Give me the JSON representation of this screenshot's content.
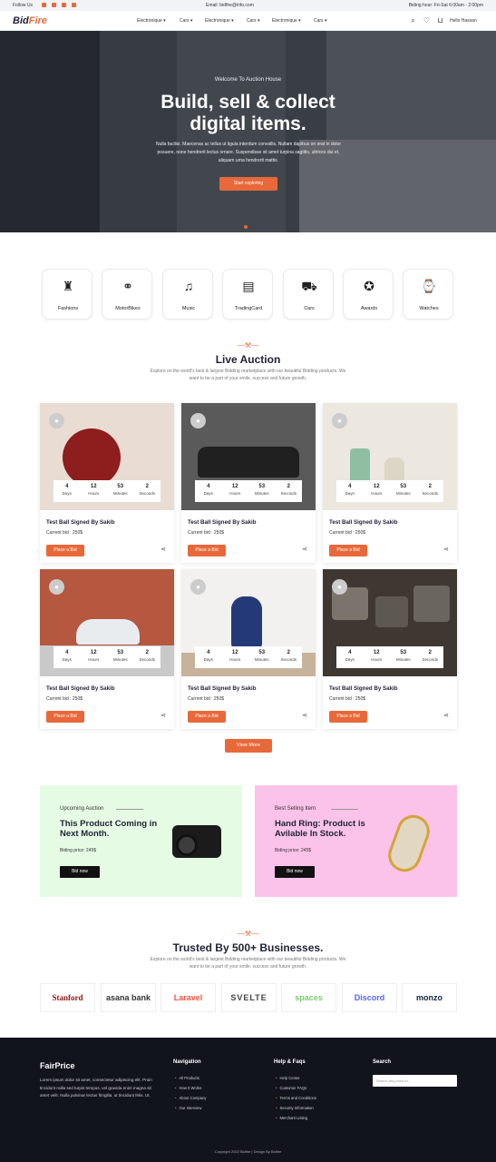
{
  "topbar": {
    "follow": "Follow Us",
    "email": "Email: bidfire@info.com",
    "hours": "Biding hour: Fri-Sat 6:00am - 2:00pm"
  },
  "nav": {
    "logo_a": "Bid",
    "logo_b": "Fire",
    "items": [
      "Electronique",
      "Cars",
      "Electronique",
      "Cars",
      "Electronique",
      "Cars"
    ],
    "user": "Hello Hassan"
  },
  "hero": {
    "kicker": "Welcome To Auction House",
    "title_line1": "Build, sell & collect",
    "title_line2": "digital items.",
    "subtitle": "Nulla facilisi. Maecenas ac tellus ut ligula interdum convallis. Nullam dapibus on erat in dolor posuere, none hendrerit lectus ornare. Suspendisse sit amet turpina sagittis, ultrices dui et, aliquam urna hendrerit mattis.",
    "cta": "Start exploring"
  },
  "categories": [
    {
      "label": "Fashions",
      "icon": "fashion-icon"
    },
    {
      "label": "MotorBikes",
      "icon": "motorbike-icon"
    },
    {
      "label": "Music",
      "icon": "music-icon"
    },
    {
      "label": "TradingCard",
      "icon": "trading-card-icon"
    },
    {
      "label": "Cars",
      "icon": "car-icon"
    },
    {
      "label": "Awards",
      "icon": "award-icon"
    },
    {
      "label": "Watches",
      "icon": "watch-icon"
    }
  ],
  "live": {
    "title": "Live Auction",
    "subtitle": "Explore on the world's best & largest Bidding marketplace with our beautiful Bidding products. We want to be a part of your smile, success and future growth.",
    "units": [
      "Days",
      "Hours",
      "Minutes",
      "Seconds"
    ],
    "cards": [
      {
        "title": "Test Ball Signed By Sakib",
        "price": "Current bid : 250$",
        "bid": "Place a Bid",
        "countdown": [
          "4",
          "12",
          "53",
          "2"
        ],
        "image": "cricket-ball"
      },
      {
        "title": "Test Ball Signed By Sakib",
        "price": "Current bid : 250$",
        "bid": "Place a Bid",
        "countdown": [
          "4",
          "12",
          "53",
          "2"
        ],
        "image": "vintage-car"
      },
      {
        "title": "Test Ball Signed By Sakib",
        "price": "Current bid : 250$",
        "bid": "Place a Bid",
        "countdown": [
          "4",
          "12",
          "53",
          "2"
        ],
        "image": "vases"
      },
      {
        "title": "Test Ball Signed By Sakib",
        "price": "Current bid : 250$",
        "bid": "Place a Bid",
        "countdown": [
          "4",
          "12",
          "53",
          "2"
        ],
        "image": "beetle"
      },
      {
        "title": "Test Ball Signed By Sakib",
        "price": "Current bid : 250$",
        "bid": "Place a Bid",
        "countdown": [
          "4",
          "12",
          "53",
          "2"
        ],
        "image": "porcelain"
      },
      {
        "title": "Test Ball Signed By Sakib",
        "price": "Current bid : 250$",
        "bid": "Place a Bid",
        "countdown": [
          "4",
          "12",
          "53",
          "2"
        ],
        "image": "cameras"
      }
    ],
    "view_more": "View More"
  },
  "promos": [
    {
      "kicker": "Upcoming Auction",
      "title": "This Product Coming in Next Month.",
      "price": "Biding price: 245$",
      "btn": "Bid now",
      "color": "#e6fbe4"
    },
    {
      "kicker": "Best Selling Item",
      "title": "Hand Ring: Product is Avilable In Stock.",
      "price": "Biding price: 245$",
      "btn": "Bid now",
      "color": "#fbc3ea"
    }
  ],
  "trusted": {
    "title": "Trusted By 500+ Businesses.",
    "subtitle": "Explore on the world's best & largest Bidding marketplace with our beautiful Bidding products. We want to be a part of your smile, success and future growth.",
    "logos": [
      "Stanford",
      "asana bank",
      "Laravel",
      "SVELTE",
      "spaces",
      "Discord",
      "monzo"
    ]
  },
  "footer": {
    "brand": "FairPrice",
    "desc": "Lorem ipsum dolor sit amet, consectetur adipiscing elit. Proin tincidunt nulla sed turpis tempus, vel gravida enim magna sit amet velit. Nulla pulvinar lectus fringilla, ut tincidunt felis. Ut.",
    "nav_title": "Navigation",
    "nav_links": [
      "All Products",
      "How It Works",
      "About Company",
      "Our Interview"
    ],
    "help_title": "Help & Faqs",
    "help_links": [
      "Help Center",
      "Customer FAQs",
      "Terms and Conditions",
      "Security Information",
      "Merchant Listing"
    ],
    "search_title": "Search",
    "search_placeholder": "Search any product...",
    "copyright": "Copyright 2022 Bidfire | Design By Bidfire"
  }
}
